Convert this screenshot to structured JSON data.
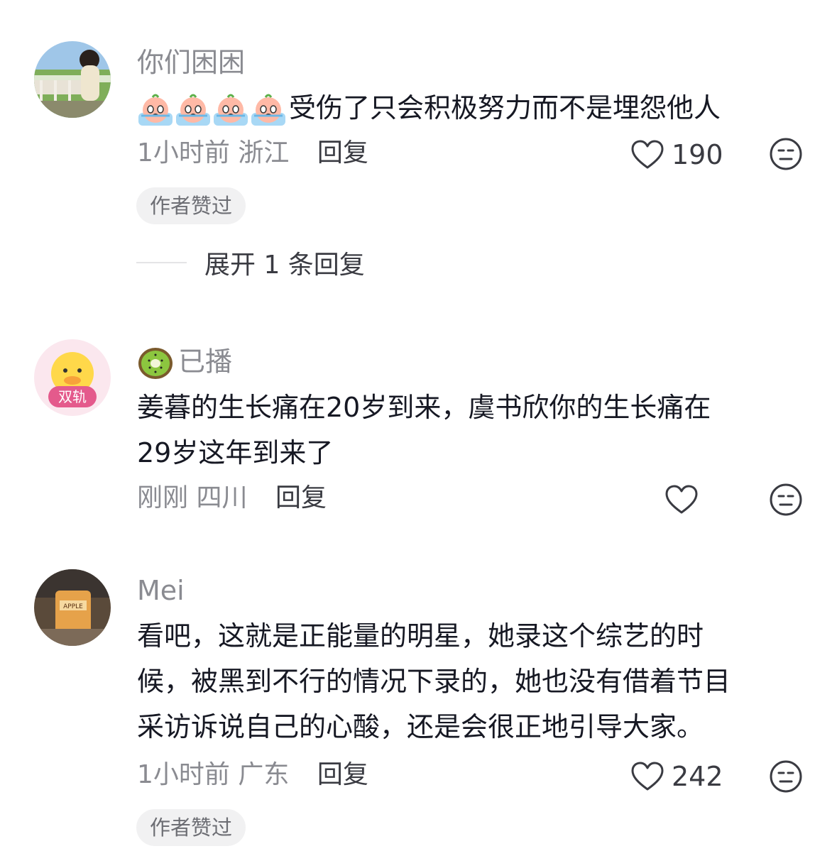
{
  "comments": [
    {
      "username": "你们困困",
      "text": "受伤了只会积极努力而不是埋怨他人",
      "emojis": [
        "crying-face-icon",
        "crying-face-icon",
        "crying-face-icon",
        "crying-face-icon"
      ],
      "time": "1小时前",
      "location": "浙江",
      "reply_label": "回复",
      "likes": "190",
      "author_liked": "作者赞过",
      "expand_label": "展开 1 条回复"
    },
    {
      "username": "已播",
      "username_icon": "kiwi-icon",
      "text_line1": "姜暮的生长痛在20岁到来，虞书欣你的生长痛在",
      "text_line2": "29岁这年到来了",
      "time": "刚刚",
      "location": "四川",
      "reply_label": "回复"
    },
    {
      "username": "Mei",
      "text_line1": "看吧，这就是正能量的明星，她录这个综艺的时",
      "text_line2": "候，被黑到不行的情况下录的，她也没有借着节目",
      "text_line3": "采访诉说自己的心酸，还是会很正地引导大家。",
      "time": "1小时前",
      "location": "广东",
      "reply_label": "回复",
      "likes": "242",
      "author_liked": "作者赞过"
    }
  ],
  "colors": {
    "meta": "#8a8b91",
    "text": "#161823",
    "pill_bg": "#f1f1f2"
  }
}
